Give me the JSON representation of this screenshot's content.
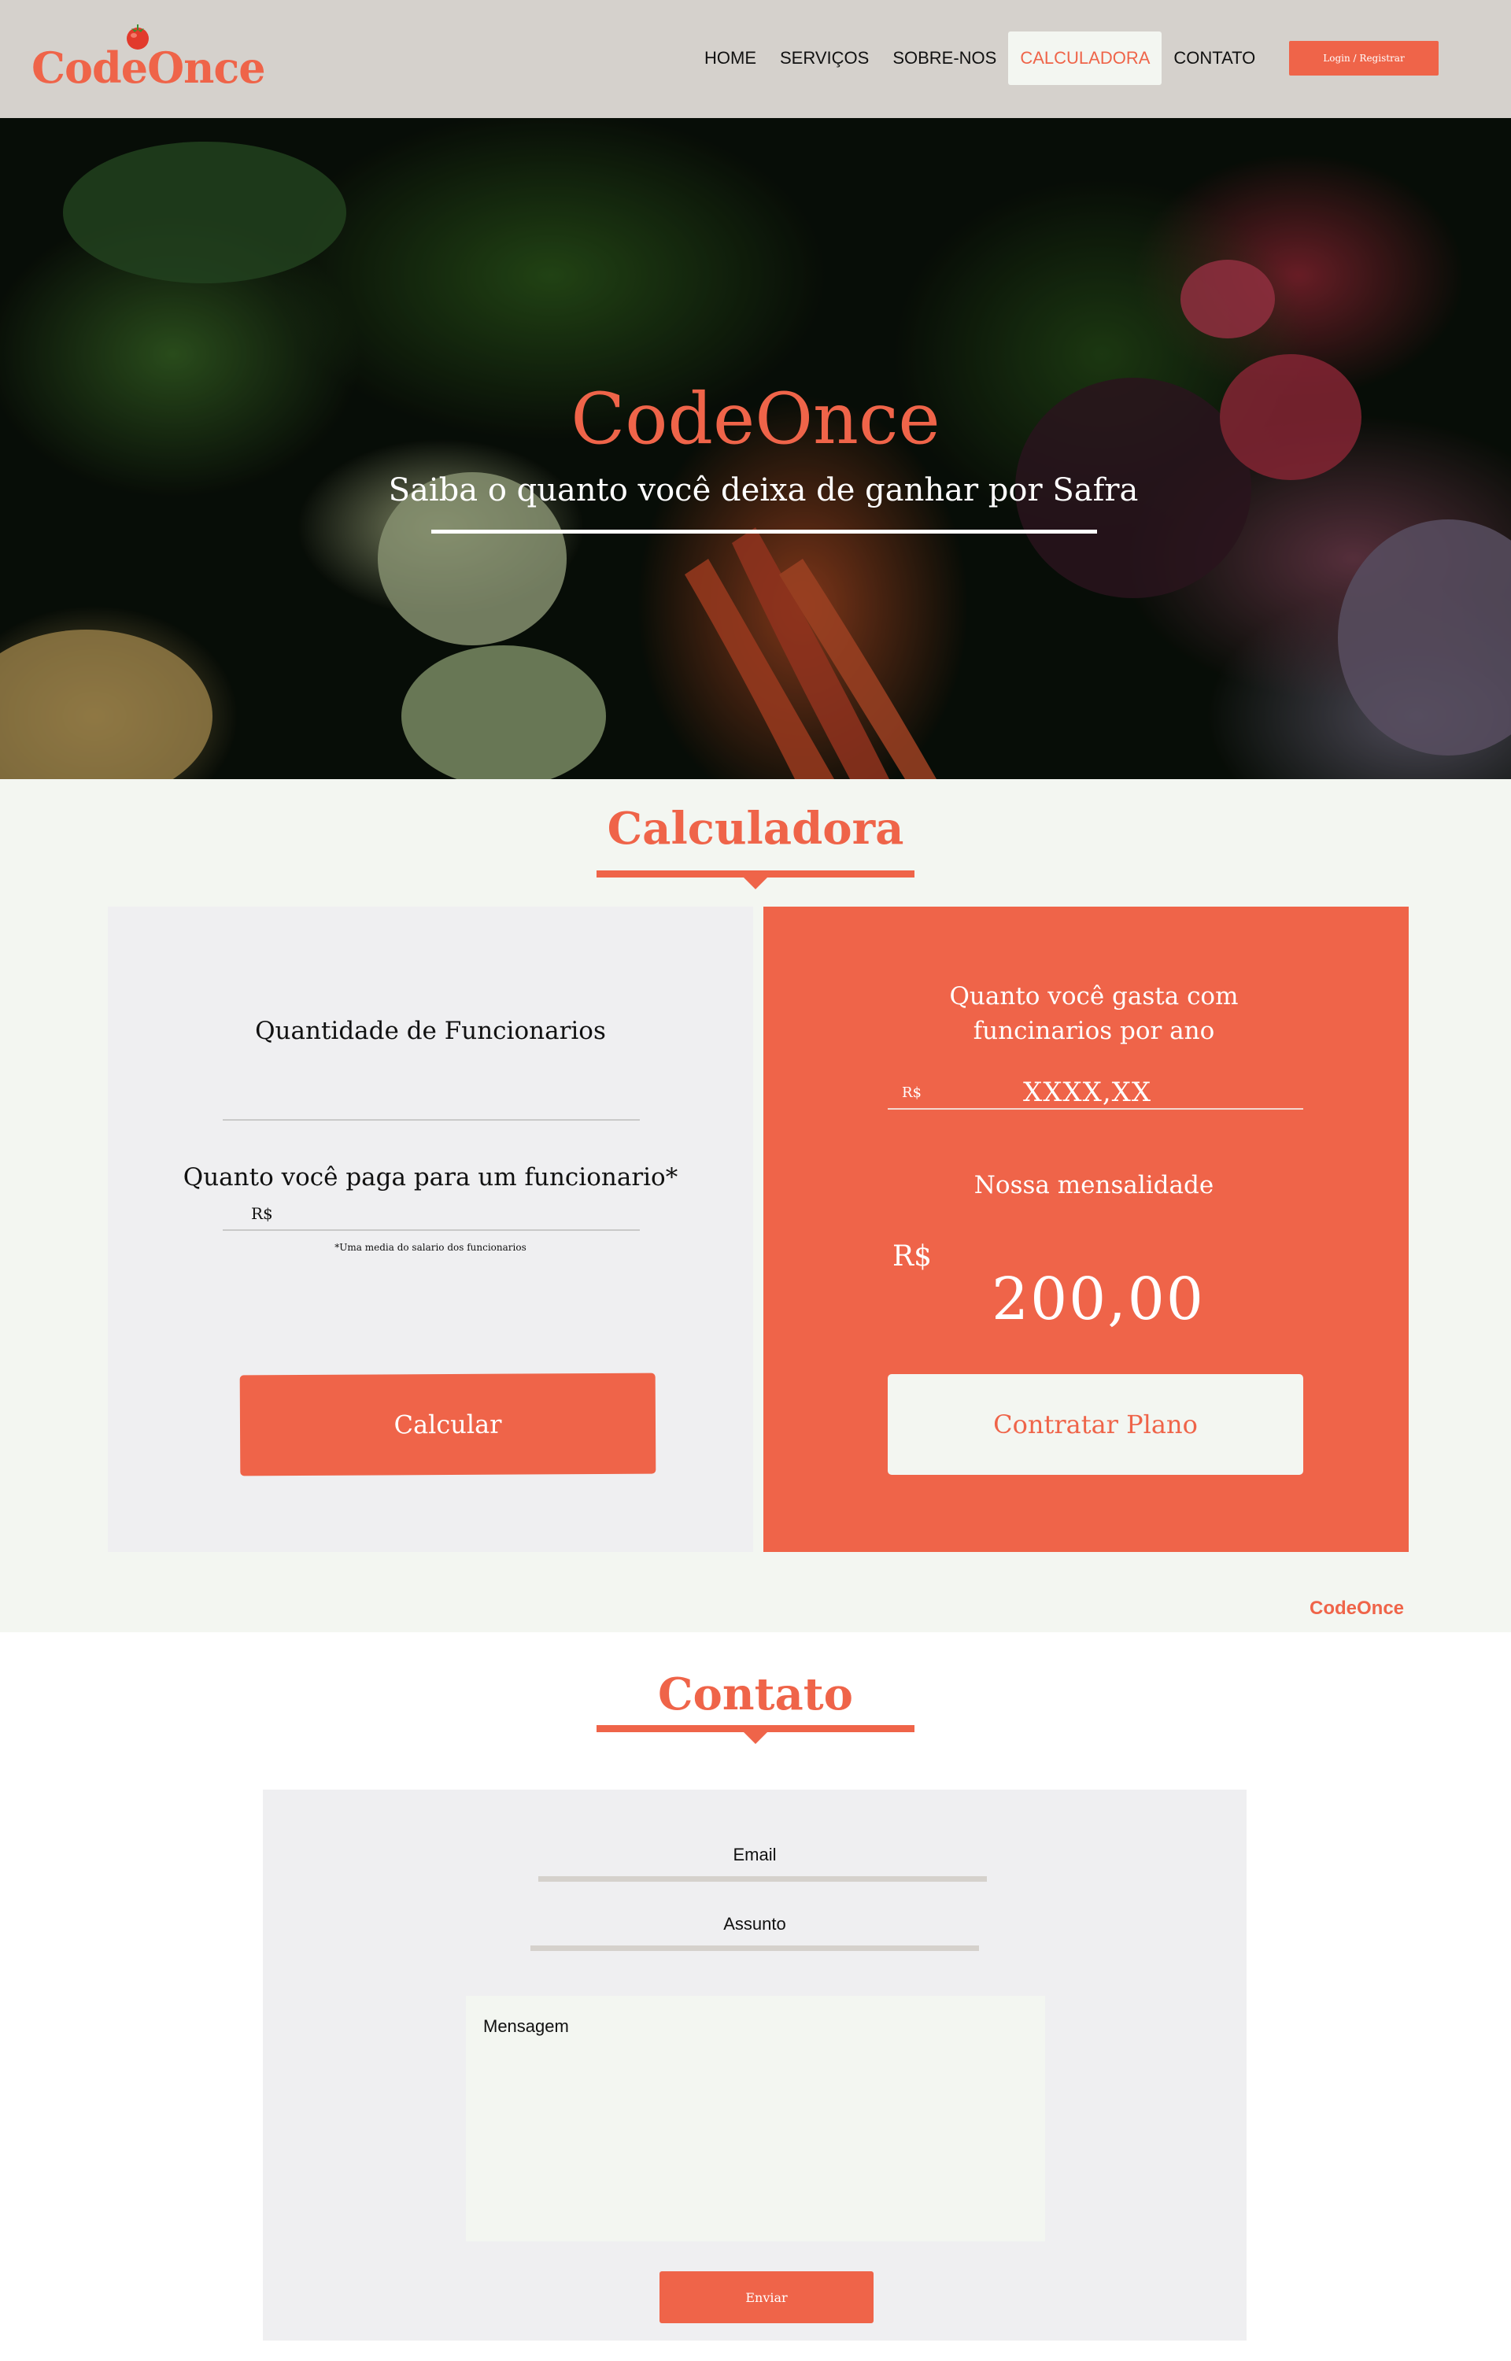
{
  "brand": {
    "logo_text": "CodeOnce",
    "accent_color": "#ef6449",
    "tomato_icon": "tomato-icon"
  },
  "nav": {
    "items": [
      {
        "label": "HOME",
        "active": false
      },
      {
        "label": "SERVIÇOS",
        "active": false
      },
      {
        "label": "SOBRE-NOS",
        "active": false
      },
      {
        "label": "CALCULADORA",
        "active": true
      },
      {
        "label": "CONTATO",
        "active": false
      }
    ],
    "login_label": "Login /  Registrar"
  },
  "hero": {
    "title": "CodeOnce",
    "subtitle": "Saiba o quanto você deixa de ganhar por Safra"
  },
  "calculator": {
    "title": "Calculadora",
    "left": {
      "employees_label": "Quantidade de Funcionarios",
      "employees_value": "",
      "salary_label": "Quanto você paga para um funcionario*",
      "salary_prefix": "R$",
      "salary_value": "",
      "note": "*Uma media do salario dos funcionarios",
      "calc_button": "Calcular"
    },
    "right": {
      "cost_label_line1": "Quanto você gasta com",
      "cost_label_line2": "funcinarios por ano",
      "cost_prefix": "R$",
      "cost_value": "XXXX,XX",
      "monthly_label": "Nossa mensalidade",
      "monthly_prefix": "R$",
      "monthly_value": "200,00",
      "plan_button": "Contratar Plano"
    },
    "footer_brand": "CodeOnce"
  },
  "contact": {
    "title": "Contato",
    "email_label": "Email",
    "subject_label": "Assunto",
    "message_placeholder": "Mensagem",
    "send_button": "Enviar"
  }
}
